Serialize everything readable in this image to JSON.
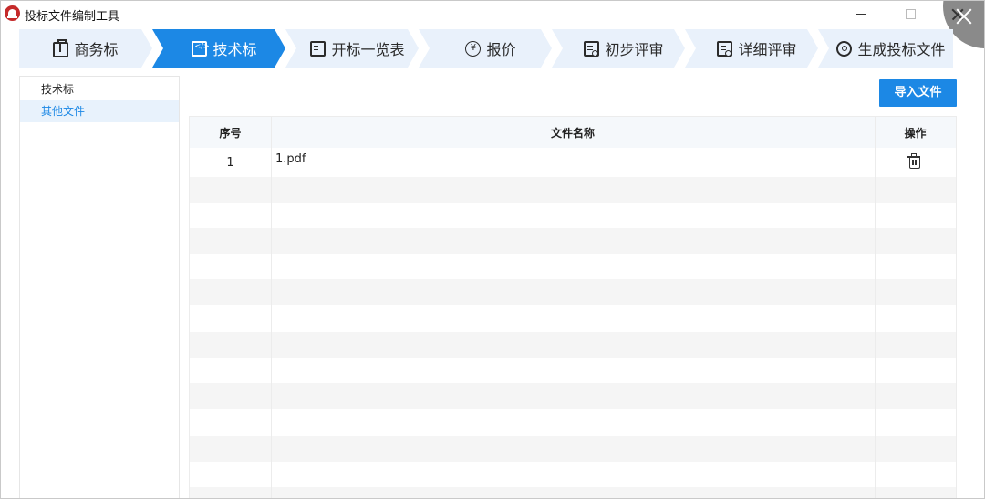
{
  "window": {
    "title": "投标文件编制工具"
  },
  "steps": [
    {
      "label": "商务标",
      "icon": "briefcase-icon",
      "active": false
    },
    {
      "label": "技术标",
      "icon": "code-icon",
      "active": true
    },
    {
      "label": "开标一览表",
      "icon": "document-icon",
      "active": false
    },
    {
      "label": "报价",
      "icon": "yen-icon",
      "active": false
    },
    {
      "label": "初步评审",
      "icon": "review-icon",
      "active": false
    },
    {
      "label": "详细评审",
      "icon": "review-icon",
      "active": false
    },
    {
      "label": "生成投标文件",
      "icon": "generate-icon",
      "active": false
    }
  ],
  "sidebar": {
    "items": [
      {
        "label": "技术标",
        "active": false
      },
      {
        "label": "其他文件",
        "active": true
      }
    ]
  },
  "toolbar": {
    "import_label": "导入文件"
  },
  "table": {
    "columns": [
      "序号",
      "文件名称",
      "操作"
    ],
    "rows": [
      {
        "index": "1",
        "name": "1.pdf",
        "action_icon": "trash-icon"
      }
    ]
  },
  "colors": {
    "accent": "#1c88e5",
    "step_bg": "#e9f1fb",
    "sidebar_active_bg": "#e8f2fc",
    "stripe": "#f5f5f5"
  }
}
